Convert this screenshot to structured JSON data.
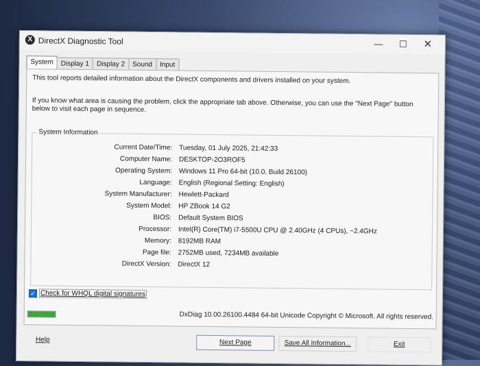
{
  "window": {
    "title": "DirectX Diagnostic Tool",
    "icon": "directx-x-icon",
    "controls": {
      "minimize": "—",
      "maximize": "☐",
      "close": "✕"
    }
  },
  "tabs": [
    {
      "label": "System",
      "active": true
    },
    {
      "label": "Display 1",
      "active": false
    },
    {
      "label": "Display 2",
      "active": false
    },
    {
      "label": "Sound",
      "active": false
    },
    {
      "label": "Input",
      "active": false
    }
  ],
  "intro": {
    "line1": "This tool reports detailed information about the DirectX components and drivers installed on your system.",
    "line2": "If you know what area is causing the problem, click the appropriate tab above.  Otherwise, you can use the \"Next Page\" button below to visit each page in sequence."
  },
  "system_info": {
    "group_label": "System Information",
    "rows": [
      {
        "label": "Current Date/Time:",
        "value": "Tuesday, 01 July 2025, 21:42:33"
      },
      {
        "label": "Computer Name:",
        "value": "DESKTOP-2O3ROF5"
      },
      {
        "label": "Operating System:",
        "value": "Windows 11 Pro 64-bit (10.0, Build 26100)"
      },
      {
        "label": "Language:",
        "value": "English (Regional Setting: English)"
      },
      {
        "label": "System Manufacturer:",
        "value": "Hewlett-Packard"
      },
      {
        "label": "System Model:",
        "value": "HP ZBook 14 G2"
      },
      {
        "label": "BIOS:",
        "value": "Default System BIOS"
      },
      {
        "label": "Processor:",
        "value": "Intel(R) Core(TM) i7-5500U CPU @ 2.40GHz (4 CPUs), ~2.4GHz"
      },
      {
        "label": "Memory:",
        "value": "8192MB RAM"
      },
      {
        "label": "Page file:",
        "value": "2752MB used, 7234MB available"
      },
      {
        "label": "DirectX Version:",
        "value": "DirectX 12"
      }
    ]
  },
  "whql": {
    "label": "Check for WHQL digital signatures",
    "checked": true
  },
  "progress": {
    "value": 1.0,
    "color": "#3fa53f"
  },
  "copyright": "DxDiag 10.00.26100.4484 64-bit Unicode  Copyright © Microsoft. All rights reserved.",
  "buttons": {
    "help": "Help",
    "next_page": "Next Page",
    "save_all": "Save All Information...",
    "exit": "Exit"
  }
}
